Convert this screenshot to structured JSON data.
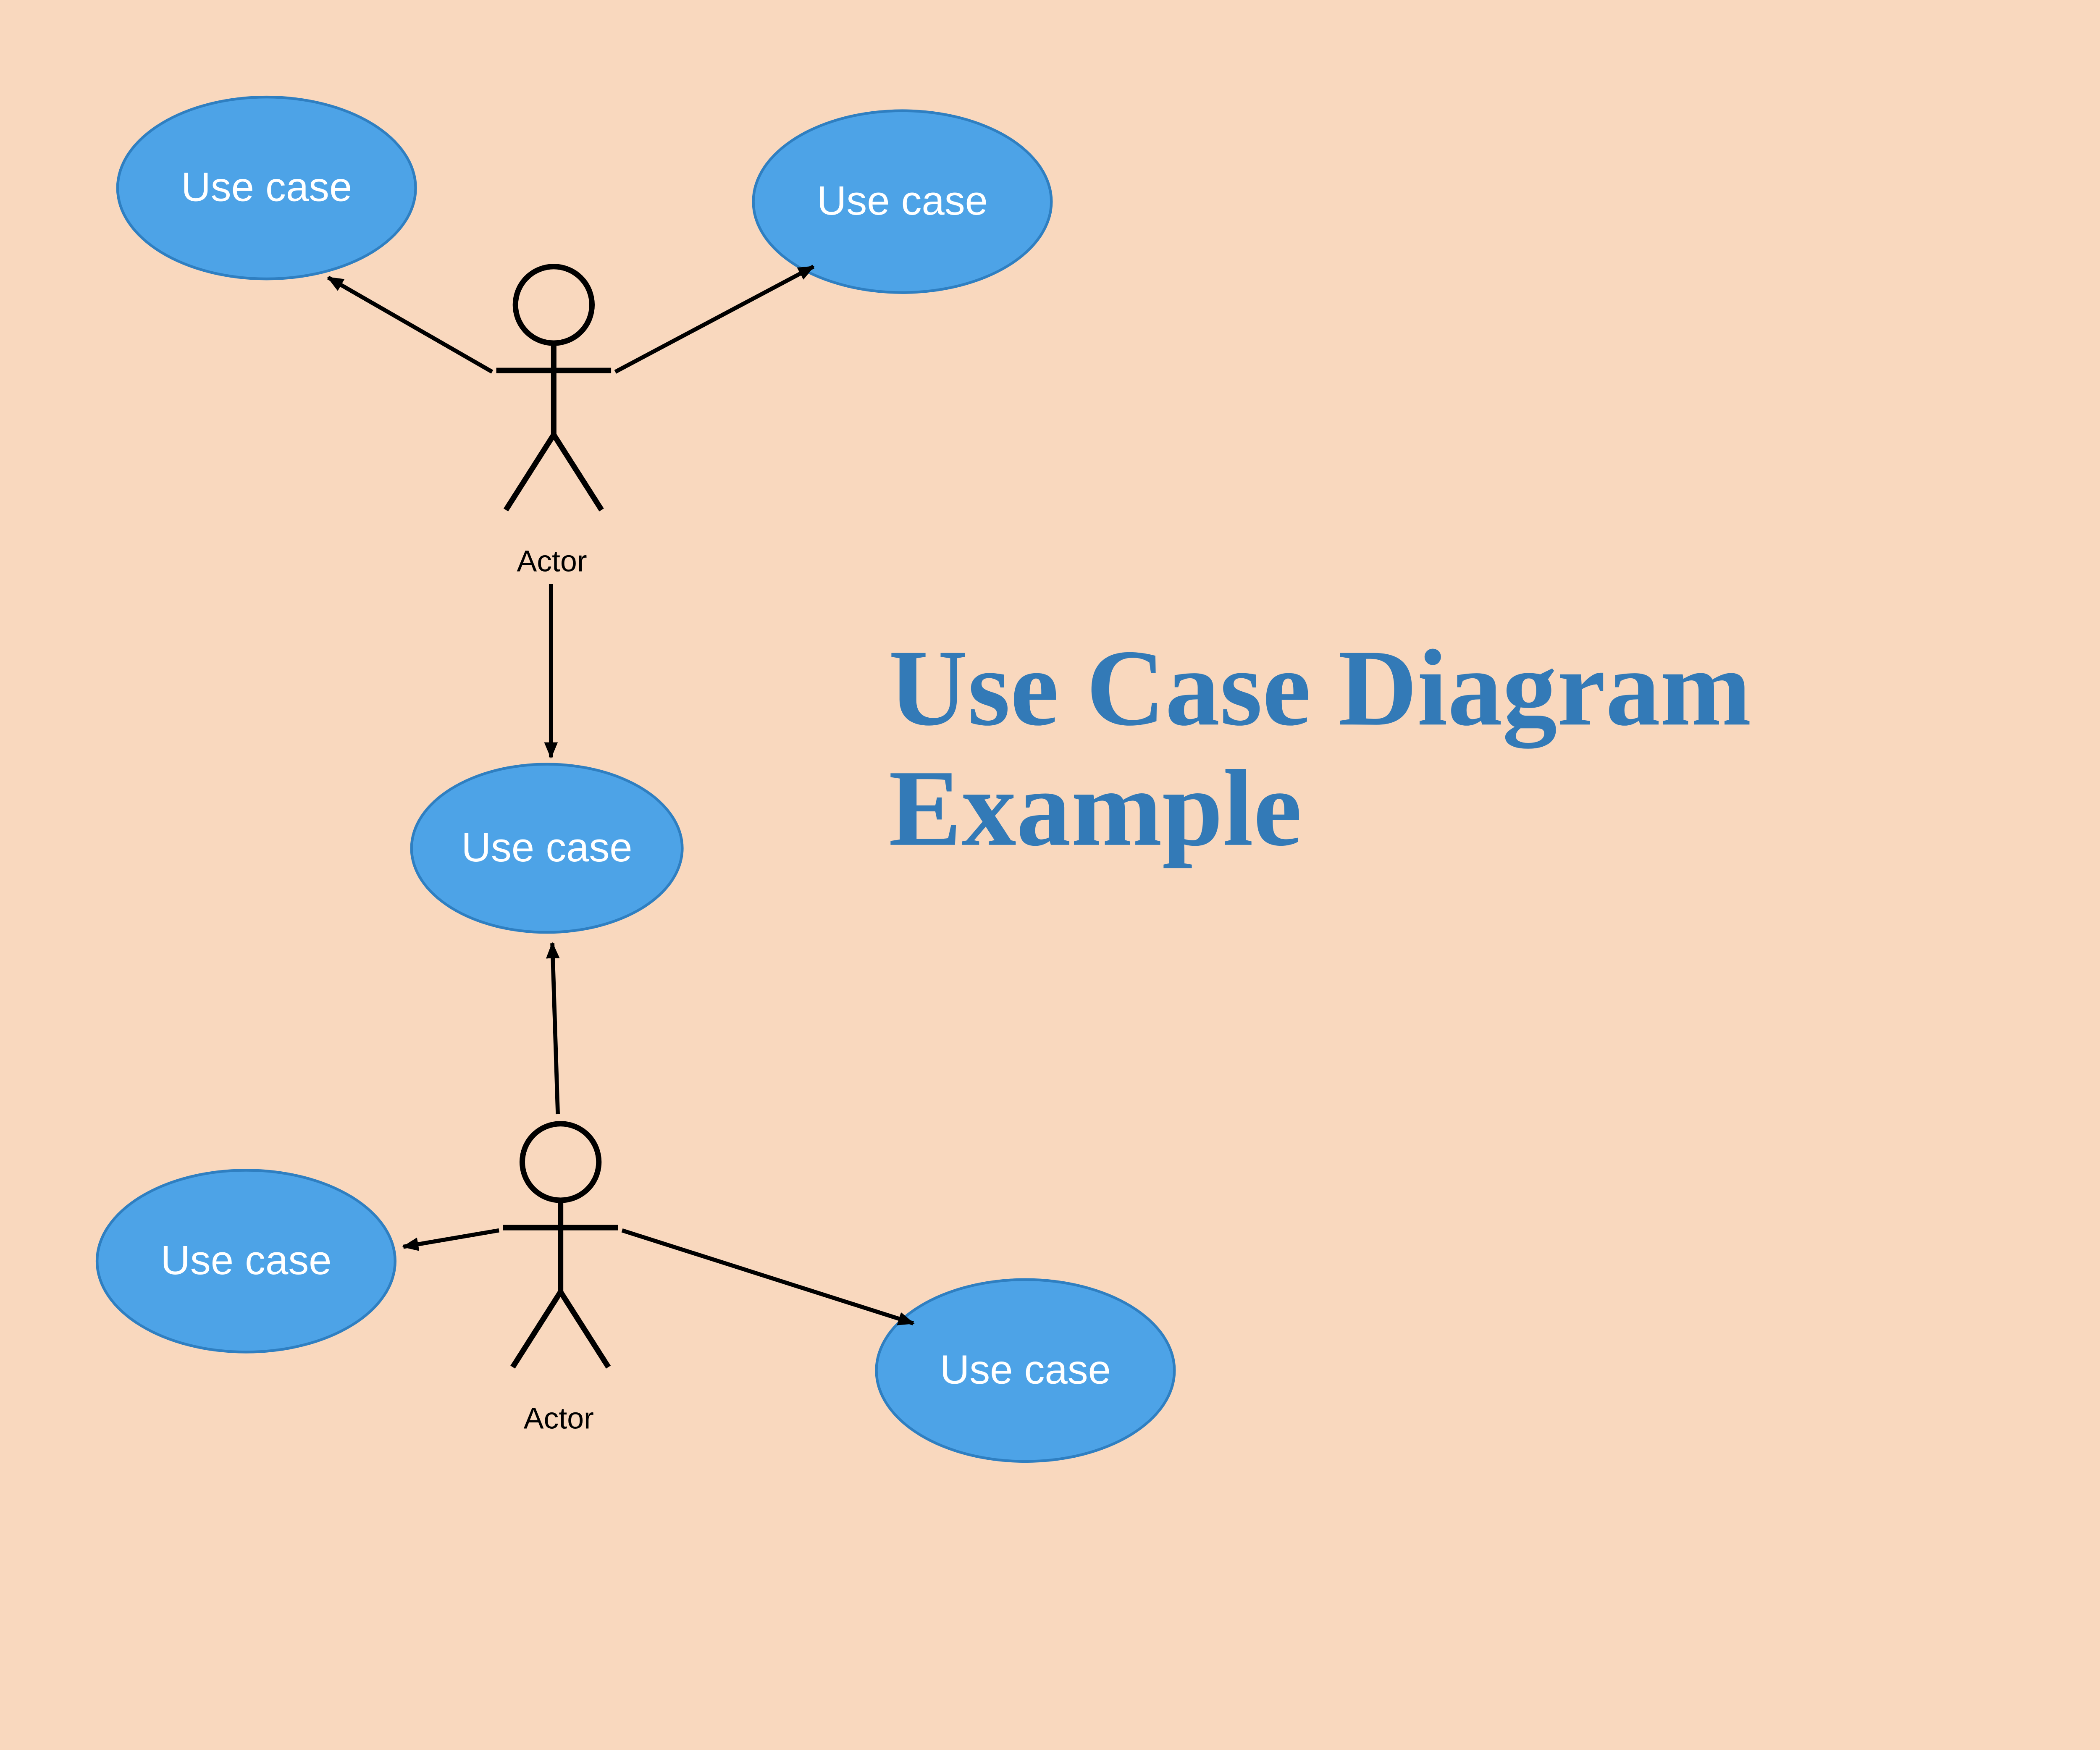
{
  "title_line1": "Use Case Diagram",
  "title_line2": "Example",
  "usecases": {
    "uc1": "Use case",
    "uc2": "Use case",
    "uc3": "Use case",
    "uc4": "Use case",
    "uc5": "Use case"
  },
  "actors": {
    "a1": "Actor",
    "a2": "Actor"
  },
  "colors": {
    "background": "#f9d8be",
    "ellipse_fill": "#4da3e7",
    "ellipse_stroke": "#2f7fc1",
    "title": "#337ab7"
  }
}
